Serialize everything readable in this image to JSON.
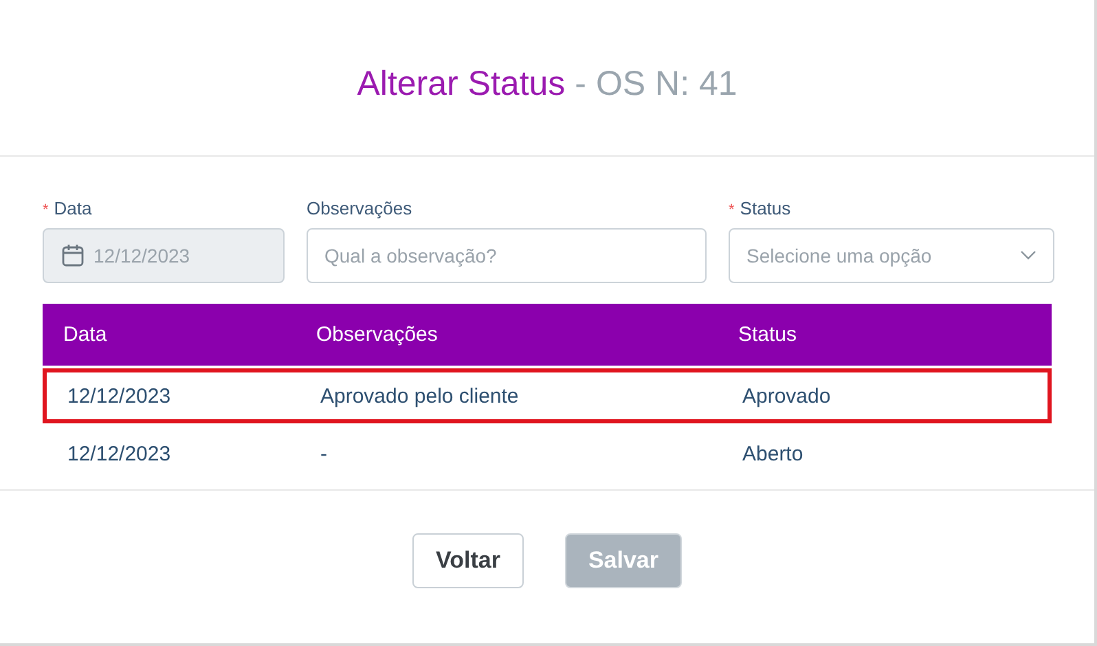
{
  "modal": {
    "title": "Alterar Status",
    "subtitle": "- OS N: 41"
  },
  "fields": [
    {
      "kind": "date",
      "label": "Data",
      "required_mark": "*",
      "value": "12/12/2023",
      "disabled": true
    },
    {
      "kind": "text",
      "label": "Observações",
      "placeholder": "Qual a observação?",
      "disabled": false
    },
    {
      "kind": "select",
      "label": "Status",
      "required_mark": "*",
      "placeholder": "Selecione uma opção",
      "disabled": false
    }
  ],
  "table": {
    "columns": [
      "Data",
      "Observações",
      "Status"
    ],
    "rows": [
      {
        "cells": [
          "12/12/2023",
          "Aprovado pelo cliente",
          "Aprovado"
        ],
        "highlighted": true
      },
      {
        "cells": [
          "12/12/2023",
          "-",
          "Aberto"
        ],
        "highlighted": false
      }
    ]
  },
  "buttons": [
    {
      "label": "Voltar",
      "disabled": false
    },
    {
      "label": "Salvar",
      "disabled": true
    }
  ]
}
